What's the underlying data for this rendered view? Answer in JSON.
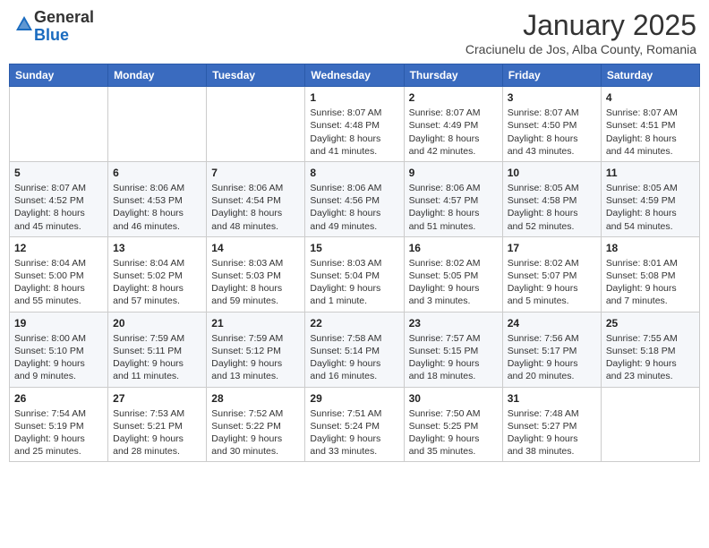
{
  "logo": {
    "general": "General",
    "blue": "Blue"
  },
  "header": {
    "month": "January 2025",
    "location": "Craciunelu de Jos, Alba County, Romania"
  },
  "weekdays": [
    "Sunday",
    "Monday",
    "Tuesday",
    "Wednesday",
    "Thursday",
    "Friday",
    "Saturday"
  ],
  "weeks": [
    [
      {
        "day": "",
        "info": ""
      },
      {
        "day": "",
        "info": ""
      },
      {
        "day": "",
        "info": ""
      },
      {
        "day": "1",
        "info": "Sunrise: 8:07 AM\nSunset: 4:48 PM\nDaylight: 8 hours and 41 minutes."
      },
      {
        "day": "2",
        "info": "Sunrise: 8:07 AM\nSunset: 4:49 PM\nDaylight: 8 hours and 42 minutes."
      },
      {
        "day": "3",
        "info": "Sunrise: 8:07 AM\nSunset: 4:50 PM\nDaylight: 8 hours and 43 minutes."
      },
      {
        "day": "4",
        "info": "Sunrise: 8:07 AM\nSunset: 4:51 PM\nDaylight: 8 hours and 44 minutes."
      }
    ],
    [
      {
        "day": "5",
        "info": "Sunrise: 8:07 AM\nSunset: 4:52 PM\nDaylight: 8 hours and 45 minutes."
      },
      {
        "day": "6",
        "info": "Sunrise: 8:06 AM\nSunset: 4:53 PM\nDaylight: 8 hours and 46 minutes."
      },
      {
        "day": "7",
        "info": "Sunrise: 8:06 AM\nSunset: 4:54 PM\nDaylight: 8 hours and 48 minutes."
      },
      {
        "day": "8",
        "info": "Sunrise: 8:06 AM\nSunset: 4:56 PM\nDaylight: 8 hours and 49 minutes."
      },
      {
        "day": "9",
        "info": "Sunrise: 8:06 AM\nSunset: 4:57 PM\nDaylight: 8 hours and 51 minutes."
      },
      {
        "day": "10",
        "info": "Sunrise: 8:05 AM\nSunset: 4:58 PM\nDaylight: 8 hours and 52 minutes."
      },
      {
        "day": "11",
        "info": "Sunrise: 8:05 AM\nSunset: 4:59 PM\nDaylight: 8 hours and 54 minutes."
      }
    ],
    [
      {
        "day": "12",
        "info": "Sunrise: 8:04 AM\nSunset: 5:00 PM\nDaylight: 8 hours and 55 minutes."
      },
      {
        "day": "13",
        "info": "Sunrise: 8:04 AM\nSunset: 5:02 PM\nDaylight: 8 hours and 57 minutes."
      },
      {
        "day": "14",
        "info": "Sunrise: 8:03 AM\nSunset: 5:03 PM\nDaylight: 8 hours and 59 minutes."
      },
      {
        "day": "15",
        "info": "Sunrise: 8:03 AM\nSunset: 5:04 PM\nDaylight: 9 hours and 1 minute."
      },
      {
        "day": "16",
        "info": "Sunrise: 8:02 AM\nSunset: 5:05 PM\nDaylight: 9 hours and 3 minutes."
      },
      {
        "day": "17",
        "info": "Sunrise: 8:02 AM\nSunset: 5:07 PM\nDaylight: 9 hours and 5 minutes."
      },
      {
        "day": "18",
        "info": "Sunrise: 8:01 AM\nSunset: 5:08 PM\nDaylight: 9 hours and 7 minutes."
      }
    ],
    [
      {
        "day": "19",
        "info": "Sunrise: 8:00 AM\nSunset: 5:10 PM\nDaylight: 9 hours and 9 minutes."
      },
      {
        "day": "20",
        "info": "Sunrise: 7:59 AM\nSunset: 5:11 PM\nDaylight: 9 hours and 11 minutes."
      },
      {
        "day": "21",
        "info": "Sunrise: 7:59 AM\nSunset: 5:12 PM\nDaylight: 9 hours and 13 minutes."
      },
      {
        "day": "22",
        "info": "Sunrise: 7:58 AM\nSunset: 5:14 PM\nDaylight: 9 hours and 16 minutes."
      },
      {
        "day": "23",
        "info": "Sunrise: 7:57 AM\nSunset: 5:15 PM\nDaylight: 9 hours and 18 minutes."
      },
      {
        "day": "24",
        "info": "Sunrise: 7:56 AM\nSunset: 5:17 PM\nDaylight: 9 hours and 20 minutes."
      },
      {
        "day": "25",
        "info": "Sunrise: 7:55 AM\nSunset: 5:18 PM\nDaylight: 9 hours and 23 minutes."
      }
    ],
    [
      {
        "day": "26",
        "info": "Sunrise: 7:54 AM\nSunset: 5:19 PM\nDaylight: 9 hours and 25 minutes."
      },
      {
        "day": "27",
        "info": "Sunrise: 7:53 AM\nSunset: 5:21 PM\nDaylight: 9 hours and 28 minutes."
      },
      {
        "day": "28",
        "info": "Sunrise: 7:52 AM\nSunset: 5:22 PM\nDaylight: 9 hours and 30 minutes."
      },
      {
        "day": "29",
        "info": "Sunrise: 7:51 AM\nSunset: 5:24 PM\nDaylight: 9 hours and 33 minutes."
      },
      {
        "day": "30",
        "info": "Sunrise: 7:50 AM\nSunset: 5:25 PM\nDaylight: 9 hours and 35 minutes."
      },
      {
        "day": "31",
        "info": "Sunrise: 7:48 AM\nSunset: 5:27 PM\nDaylight: 9 hours and 38 minutes."
      },
      {
        "day": "",
        "info": ""
      }
    ]
  ]
}
